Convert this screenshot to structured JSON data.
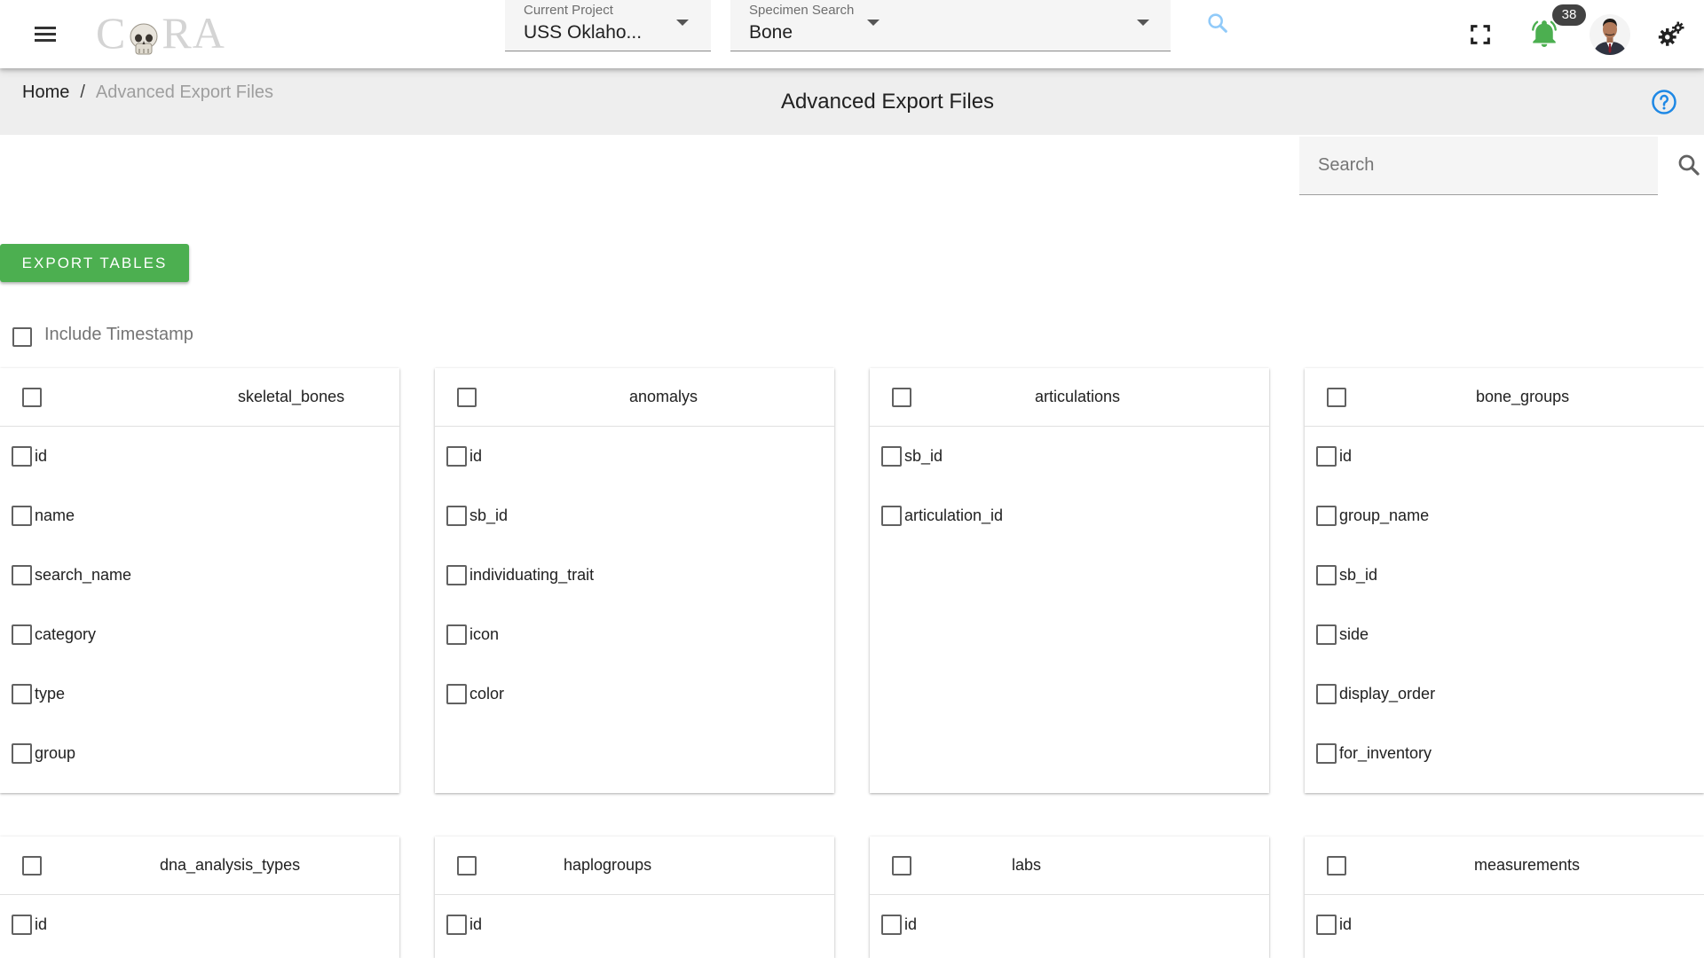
{
  "app": {
    "logo_text_left": "C",
    "logo_text_right": "RA",
    "logo_title": "CORA"
  },
  "header": {
    "project_select": {
      "label": "Current Project",
      "value": "USS Oklaho..."
    },
    "specimen_select": {
      "label": "Specimen Search",
      "value": "Bone"
    },
    "notification_count": "38",
    "icons": [
      "menu-icon",
      "search-icon",
      "fullscreen-icon",
      "bell-icon",
      "avatar",
      "settings-gears-icon"
    ],
    "bell_color": "#4caf50"
  },
  "breadcrumb": {
    "home": "Home",
    "separator": "/",
    "current": "Advanced Export Files"
  },
  "page": {
    "title": "Advanced Export Files",
    "search_placeholder": "Search",
    "export_button": "EXPORT TABLES",
    "include_timestamp": "Include Timestamp"
  },
  "colors": {
    "accent_green": "#4caf50",
    "help_blue": "#1e88e5"
  },
  "tables": [
    {
      "name": "skeletal_bones",
      "fields": [
        "id",
        "name",
        "search_name",
        "category",
        "type",
        "group"
      ]
    },
    {
      "name": "anomalys",
      "fields": [
        "id",
        "sb_id",
        "individuating_trait",
        "icon",
        "color"
      ]
    },
    {
      "name": "articulations",
      "fields": [
        "sb_id",
        "articulation_id"
      ]
    },
    {
      "name": "bone_groups",
      "fields": [
        "id",
        "group_name",
        "sb_id",
        "side",
        "display_order",
        "for_inventory"
      ]
    },
    {
      "name": "dna_analysis_types",
      "fields": [
        "id"
      ]
    },
    {
      "name": "haplogroups",
      "fields": [
        "id"
      ]
    },
    {
      "name": "labs",
      "fields": [
        "id"
      ]
    },
    {
      "name": "measurements",
      "fields": [
        "id"
      ]
    }
  ]
}
